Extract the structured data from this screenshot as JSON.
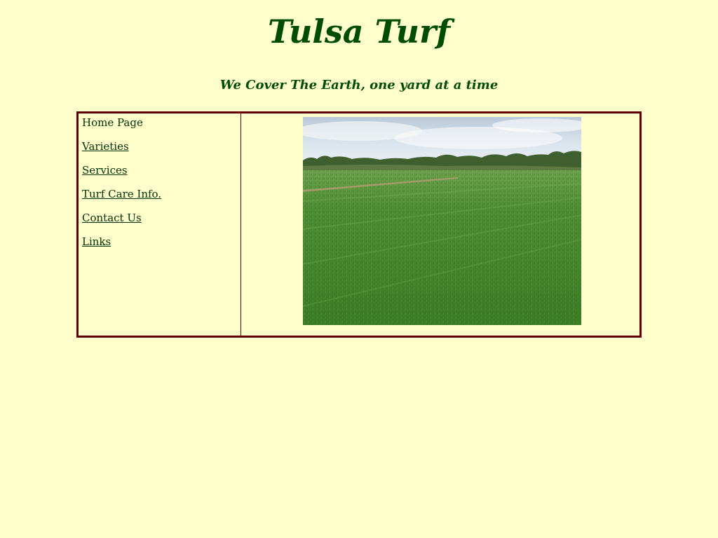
{
  "header": {
    "title": "Tulsa Turf",
    "tagline": "We Cover The Earth, one yard at a time"
  },
  "nav": {
    "items": [
      {
        "label": "Home Page",
        "current": true
      },
      {
        "label": "Varieties",
        "current": false
      },
      {
        "label": "Services",
        "current": false
      },
      {
        "label": "Turf Care Info.",
        "current": false
      },
      {
        "label": "Contact Us",
        "current": false
      },
      {
        "label": "Links",
        "current": false
      }
    ]
  },
  "colors": {
    "background": "#ffffcc",
    "title_green": "#004d00",
    "link_green": "#003300",
    "border_maroon": "#660000"
  },
  "main": {
    "image": "turf-field-photo"
  }
}
